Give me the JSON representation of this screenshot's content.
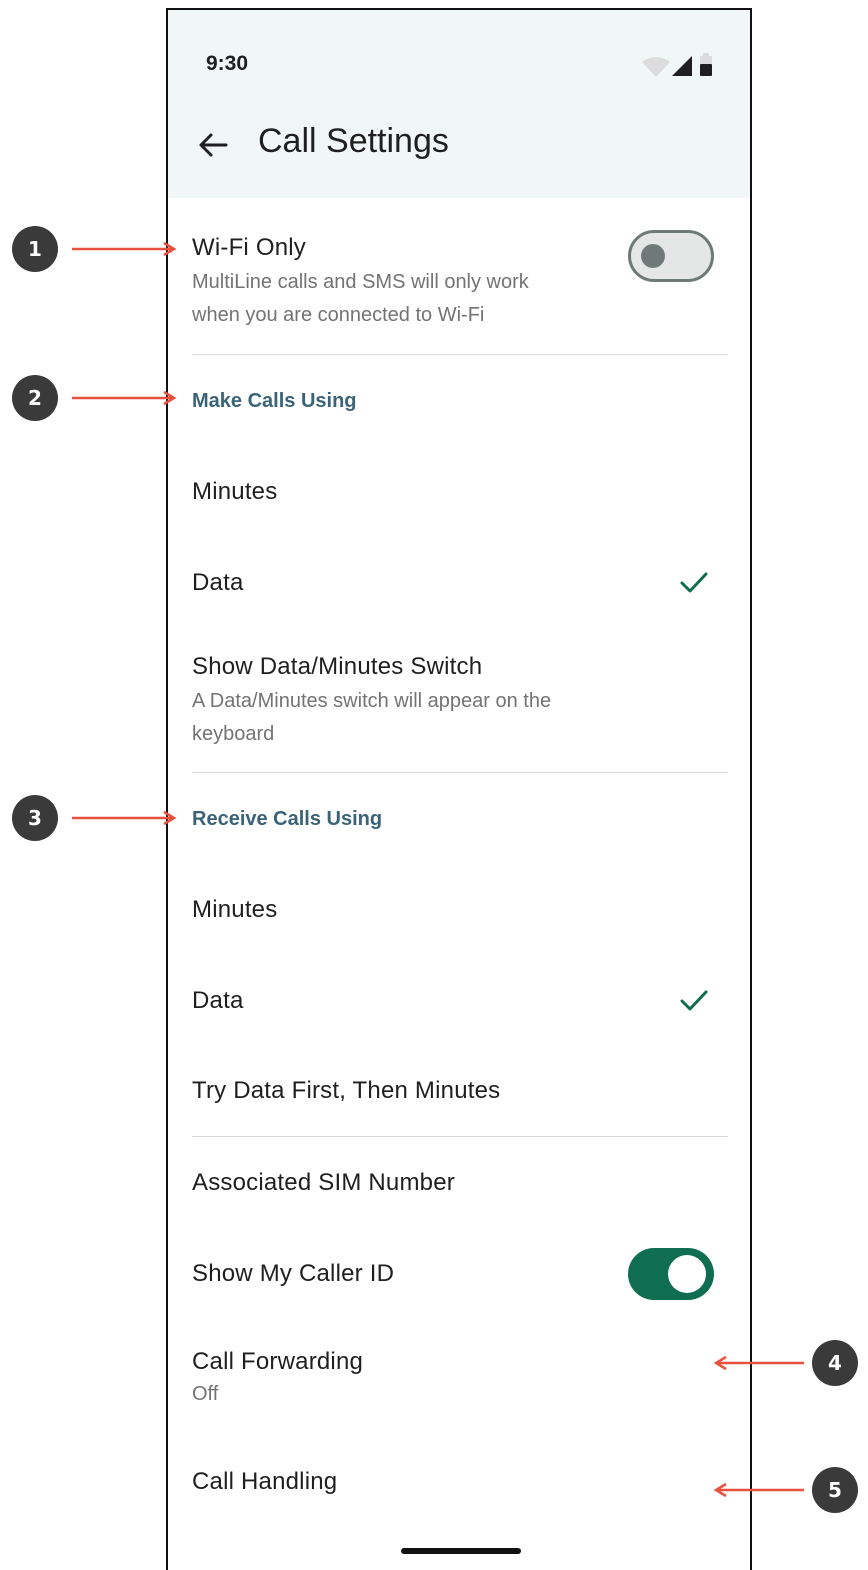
{
  "status_bar": {
    "time": "9:30"
  },
  "header": {
    "title": "Call Settings",
    "back_icon": "arrow-back-icon"
  },
  "wifi_only": {
    "label": "Wi-Fi Only",
    "description_line1": "MultiLine calls and SMS will only work",
    "description_line2": "when you are connected to Wi-Fi",
    "toggle_on": false
  },
  "make_calls": {
    "header": "Make Calls Using",
    "options": [
      {
        "label": "Minutes",
        "selected": false
      },
      {
        "label": "Data",
        "selected": true
      }
    ]
  },
  "data_minutes_switch": {
    "label": "Show Data/Minutes Switch",
    "description_line1": "A Data/Minutes switch will appear on the",
    "description_line2": "keyboard"
  },
  "receive_calls": {
    "header": "Receive Calls Using",
    "options": [
      {
        "label": "Minutes",
        "selected": false
      },
      {
        "label": "Data",
        "selected": true
      },
      {
        "label": "Try Data First, Then Minutes",
        "selected": false
      }
    ]
  },
  "associated_sim": {
    "label": "Associated SIM Number"
  },
  "caller_id": {
    "label": "Show My Caller ID",
    "toggle_on": true
  },
  "call_forwarding": {
    "label": "Call Forwarding",
    "value": "Off"
  },
  "call_handling": {
    "label": "Call Handling"
  },
  "callouts": [
    "1",
    "2",
    "3",
    "4",
    "5"
  ],
  "colors": {
    "accent": "#0f6e50",
    "section_header": "#3b6377",
    "header_bg": "#f1f7f6",
    "callout_arrow": "#e8513d",
    "callout_badge": "#3a3a3a"
  }
}
